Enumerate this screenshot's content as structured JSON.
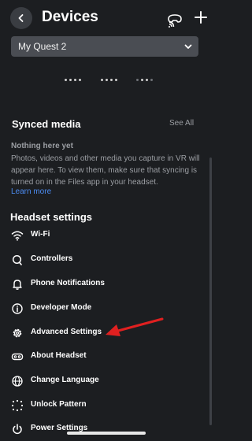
{
  "header": {
    "title": "Devices"
  },
  "device_selector": {
    "value": "My Quest 2"
  },
  "synced_media": {
    "title": "Synced media",
    "see_all": "See All",
    "empty_title": "Nothing here yet",
    "empty_body": "Photos, videos and other media you capture in VR will appear here. To view them, make sure that syncing is turned on in the Files app in your headset.",
    "learn_more": "Learn more"
  },
  "headset_settings": {
    "title": "Headset settings",
    "items": [
      {
        "label": "Wi-Fi",
        "icon": "wifi-icon"
      },
      {
        "label": "Controllers",
        "icon": "controller-icon"
      },
      {
        "label": "Phone Notifications",
        "icon": "bell-icon"
      },
      {
        "label": "Developer Mode",
        "icon": "info-icon"
      },
      {
        "label": "Advanced Settings",
        "icon": "gear-icon"
      },
      {
        "label": "About Headset",
        "icon": "headset-icon"
      },
      {
        "label": "Change Language",
        "icon": "globe-icon"
      },
      {
        "label": "Unlock Pattern",
        "icon": "pattern-icon"
      },
      {
        "label": "Power Settings",
        "icon": "power-icon"
      }
    ]
  },
  "colors": {
    "background": "#1c1e21",
    "link": "#4c8cf2",
    "arrow": "#e02020"
  }
}
